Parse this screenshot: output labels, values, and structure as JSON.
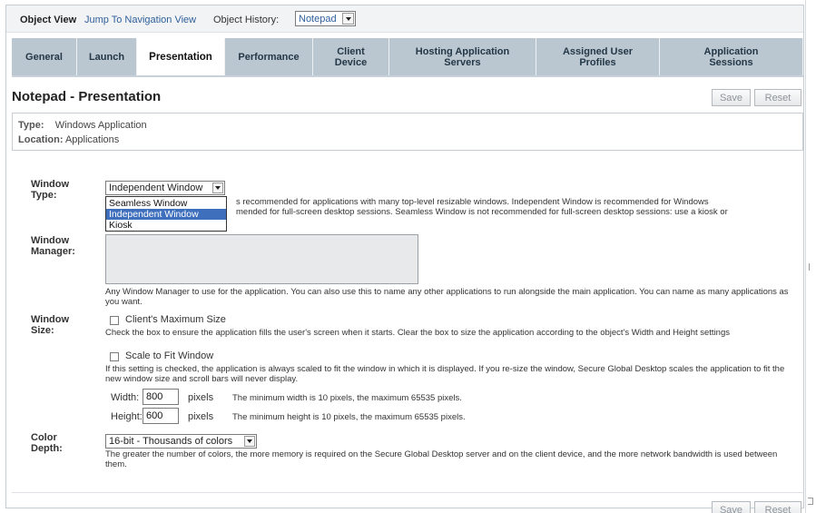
{
  "topbar": {
    "object_view": "Object View",
    "jump_link": "Jump To Navigation View",
    "object_history_label": "Object History:",
    "object_history_value": "Notepad"
  },
  "tabs": [
    {
      "label": "General"
    },
    {
      "label": "Launch"
    },
    {
      "label": "Presentation",
      "active": true
    },
    {
      "label": "Performance"
    },
    {
      "label": "Client\nDevice"
    },
    {
      "label": "Hosting Application\nServers"
    },
    {
      "label": "Assigned User\nProfiles"
    },
    {
      "label": "Application\nSessions"
    }
  ],
  "page": {
    "title": "Notepad - Presentation",
    "save": "Save",
    "reset": "Reset"
  },
  "info": {
    "type_label": "Type:",
    "type_value": "Windows Application",
    "location_label": "Location:",
    "location_value": "Applications"
  },
  "window_type": {
    "label_line1": "Window",
    "label_line2": "Type:",
    "selected": "Independent Window",
    "options": [
      "Seamless Window",
      "Independent Window",
      "Kiosk"
    ],
    "help_line1": "s recommended for applications with many top-level resizable windows. Independent Window is recommended for Windows",
    "help_line2": "mended for full-screen desktop sessions. Seamless Window is not recommended for full-screen desktop sessions: use a kiosk or"
  },
  "window_manager": {
    "label_line1": "Window",
    "label_line2": "Manager:",
    "value": "",
    "help": "Any Window Manager to use for the application. You can also use this to name any other applications to run alongside the main application. You can name as many applications as you want."
  },
  "window_size": {
    "label_line1": "Window",
    "label_line2": "Size:",
    "clients_max_label": "Client's Maximum Size",
    "clients_max_help": "Check the box to ensure the application fills the user's screen when it starts. Clear the box to size the application according to the object's Width and Height settings",
    "scale_label": "Scale to Fit Window",
    "scale_help": "If this setting is checked, the application is always scaled to fit the window in which it is displayed. If you re-size the window, Secure Global Desktop scales the application to fit the new window size and scroll bars will never display.",
    "width_label": "Width:",
    "width_value": "800",
    "width_unit": "pixels",
    "width_hint": "The minimum width is 10 pixels, the maximum 65535 pixels.",
    "height_label": "Height:",
    "height_value": "600",
    "height_unit": "pixels",
    "height_hint": "The minimum height is 10 pixels, the maximum 65535 pixels."
  },
  "color_depth": {
    "label_line1": "Color",
    "label_line2": "Depth:",
    "selected": "16-bit - Thousands of colors",
    "help": "The greater the number of colors, the more memory is required on the Secure Global Desktop server and on the client device, and the more network bandwidth is used between them."
  }
}
